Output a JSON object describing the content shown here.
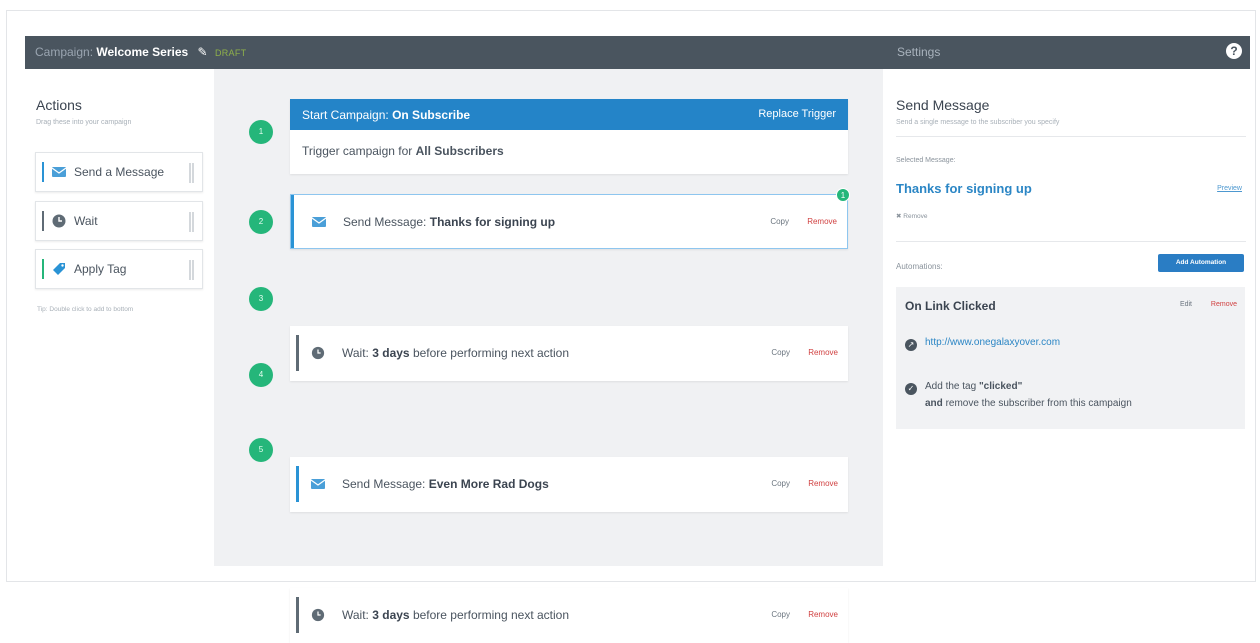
{
  "topbar": {
    "campaign_label": "Campaign:",
    "campaign_name": "Welcome Series",
    "status": "DRAFT",
    "settings": "Settings",
    "help": "?"
  },
  "actions": {
    "title": "Actions",
    "subtitle": "Drag these into your campaign",
    "items": [
      {
        "label": "Send a Message",
        "icon": "envelope-icon"
      },
      {
        "label": "Wait",
        "icon": "clock-icon"
      },
      {
        "label": "Apply Tag",
        "icon": "tag-icon"
      }
    ],
    "tip": "Tip: Double click to add to bottom"
  },
  "workflow": {
    "trigger": {
      "number": "1",
      "head_prefix": "Start Campaign:",
      "head_value": "On Subscribe",
      "replace_label": "Replace Trigger",
      "body_prefix": "Trigger campaign for",
      "body_value": "All Subscribers"
    },
    "steps": [
      {
        "number": "2",
        "prefix": "Send Message:",
        "value": "Thanks for signing up",
        "suffix": "",
        "copy": "Copy",
        "remove": "Remove"
      },
      {
        "number": "3",
        "prefix": "Wait:",
        "value": "3 days",
        "suffix": "before performing next action",
        "copy": "Copy",
        "remove": "Remove"
      },
      {
        "number": "4",
        "prefix": "Send Message:",
        "value": "Even More Rad Dogs",
        "suffix": "",
        "copy": "Copy",
        "remove": "Remove"
      },
      {
        "number": "5",
        "prefix": "Wait:",
        "value": "3 days",
        "suffix": "before performing next action",
        "copy": "Copy",
        "remove": "Remove"
      }
    ],
    "selected_badge": "1"
  },
  "settings_panel": {
    "title": "Send Message",
    "subtitle": "Send a single message to the subscriber you specify",
    "selected_label": "Selected Message:",
    "selected_message": "Thanks for signing up",
    "preview": "Preview",
    "remove": "Remove",
    "automations_label": "Automations:",
    "add_automation": "Add Automation",
    "automation": {
      "title": "On Link Clicked",
      "edit": "Edit",
      "remove": "Remove",
      "url": "http://www.onegalaxyover.com",
      "action_prefix": "Add the tag",
      "tag": "\"clicked\"",
      "action_and": "and",
      "action_rest": "remove the subscriber from this campaign"
    }
  },
  "colors": {
    "topbar": "#4a555f",
    "accent_blue": "#2484c8",
    "step_green": "#25b67a",
    "remove_red": "#d04040"
  }
}
